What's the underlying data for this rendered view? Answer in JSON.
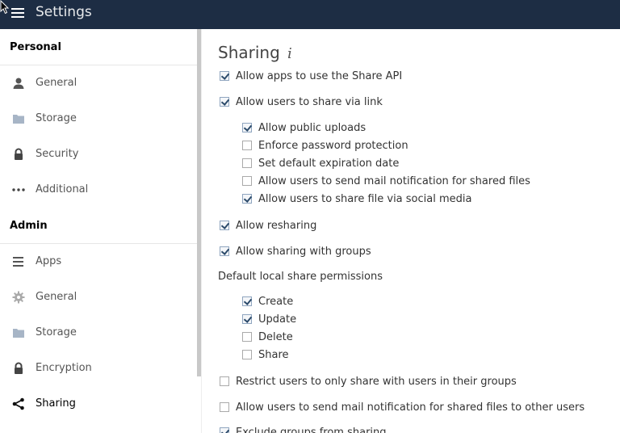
{
  "header": {
    "title": "Settings"
  },
  "sidebar": {
    "personal_heading": "Personal",
    "personal_items": [
      {
        "label": "General",
        "icon": "user-icon"
      },
      {
        "label": "Storage",
        "icon": "folder-icon"
      },
      {
        "label": "Security",
        "icon": "lock-icon"
      },
      {
        "label": "Additional",
        "icon": "more-icon"
      }
    ],
    "admin_heading": "Admin",
    "admin_items": [
      {
        "label": "Apps",
        "icon": "list-icon"
      },
      {
        "label": "General",
        "icon": "gear-icon"
      },
      {
        "label": "Storage",
        "icon": "folder-icon"
      },
      {
        "label": "Encryption",
        "icon": "lock-icon"
      },
      {
        "label": "Sharing",
        "icon": "share-icon",
        "active": true
      }
    ]
  },
  "main": {
    "title": "Sharing",
    "options": [
      {
        "label": "Allow apps to use the Share API",
        "checked": true
      },
      {
        "label": "Allow users to share via link",
        "checked": true
      },
      {
        "label": "Allow public uploads",
        "checked": true
      },
      {
        "label": "Enforce password protection",
        "checked": false
      },
      {
        "label": "Set default expiration date",
        "checked": false
      },
      {
        "label": "Allow users to send mail notification for shared files",
        "checked": false
      },
      {
        "label": "Allow users to share file via social media",
        "checked": true
      },
      {
        "label": "Allow resharing",
        "checked": true
      },
      {
        "label": "Allow sharing with groups",
        "checked": true
      }
    ],
    "permissions_label": "Default local share permissions",
    "permissions": [
      {
        "label": "Create",
        "checked": true
      },
      {
        "label": "Update",
        "checked": true
      },
      {
        "label": "Delete",
        "checked": false
      },
      {
        "label": "Share",
        "checked": false
      }
    ],
    "more_options": [
      {
        "label": "Restrict users to only share with users in their groups",
        "checked": false
      },
      {
        "label": "Allow users to send mail notification for shared files to other users",
        "checked": false
      },
      {
        "label": "Exclude groups from sharing",
        "checked": true
      }
    ]
  }
}
